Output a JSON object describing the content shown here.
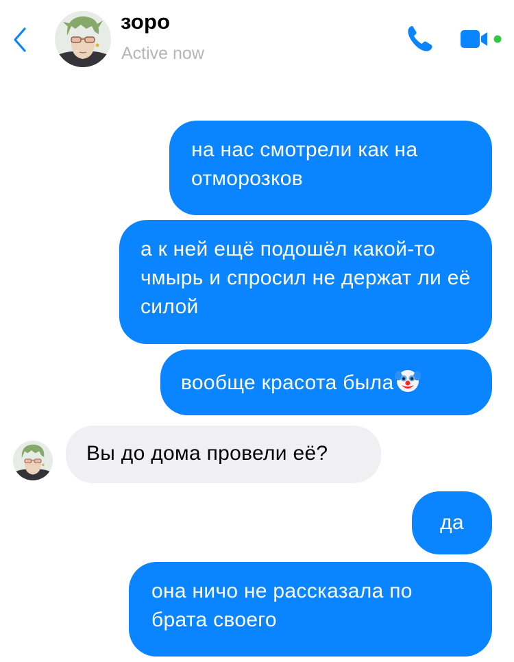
{
  "header": {
    "contact_name": "зоро",
    "status": "Active now",
    "icons": {
      "back": "chevron-left-icon",
      "call": "phone-icon",
      "video": "video-camera-icon",
      "online": "online-dot-icon"
    },
    "colors": {
      "accent": "#0a84ff",
      "online": "#31c84a",
      "status_text": "#b5b5b8"
    }
  },
  "messages": [
    {
      "direction": "outgoing",
      "text": "на нас смотрели как на отморозков"
    },
    {
      "direction": "outgoing",
      "text": "а к ней ещё подошёл какой-то чмырь и спросил не держат ли её силой"
    },
    {
      "direction": "outgoing",
      "text": "вообще красота была",
      "emoji": "clown-face"
    },
    {
      "direction": "incoming",
      "text": "Вы до дома провели её?"
    },
    {
      "direction": "outgoing",
      "text": "да"
    },
    {
      "direction": "outgoing",
      "text": "она ничо не рассказала по брата своего"
    }
  ],
  "colors": {
    "outgoing_bubble": "#0a84ff",
    "incoming_bubble": "#f0f0f3"
  }
}
